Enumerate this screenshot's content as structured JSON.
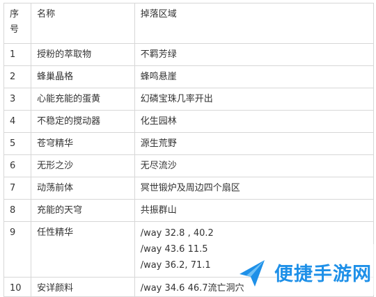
{
  "table": {
    "headers": {
      "index": "序号",
      "name": "名称",
      "drop_area": "掉落区域"
    },
    "rows": [
      {
        "index": "1",
        "name": "授粉的萃取物",
        "drop_area": "不羁芳绿"
      },
      {
        "index": "2",
        "name": "蜂巢晶格",
        "drop_area": "蜂鸣悬崖"
      },
      {
        "index": "3",
        "name": "心能充能的蛋黄",
        "drop_area": "幻磷宝珠几率开出"
      },
      {
        "index": "4",
        "name": "不稳定的搅动器",
        "drop_area": "化生园林"
      },
      {
        "index": "5",
        "name": "苍穹精华",
        "drop_area": "源生荒野"
      },
      {
        "index": "6",
        "name": "无形之沙",
        "drop_area": "无尽流沙"
      },
      {
        "index": "7",
        "name": "动荡前体",
        "drop_area": "冥世锻炉及周边四个扇区"
      },
      {
        "index": "8",
        "name": "充能的天穹",
        "drop_area": "共振群山"
      },
      {
        "index": "9",
        "name": "任性精华",
        "drop_area_lines": [
          "/way 32.8 , 40.2",
          "/way 43.6 11.5",
          "/way 36.2, 71.1"
        ]
      },
      {
        "index": "10",
        "name": "安详颜料",
        "drop_area": "/way 34.6 46.7流亡洞穴"
      }
    ]
  },
  "watermark": {
    "text": "便捷手游网",
    "color": "#1e90e8"
  }
}
